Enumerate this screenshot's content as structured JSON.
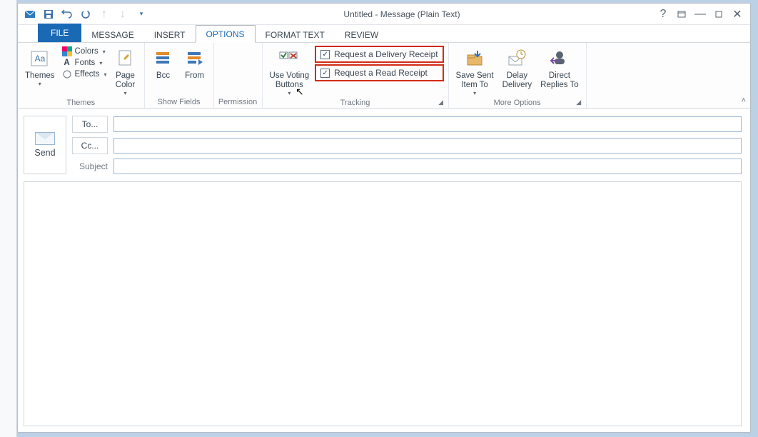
{
  "title": "Untitled - Message (Plain Text)",
  "qat": {
    "appicon": "outlook",
    "save": "save",
    "undo": "undo",
    "redo": "redo",
    "prev": "prev",
    "next": "next"
  },
  "tabs": {
    "file": "FILE",
    "message": "MESSAGE",
    "insert": "INSERT",
    "options": "OPTIONS",
    "format": "FORMAT TEXT",
    "review": "REVIEW"
  },
  "ribbon": {
    "themes": {
      "label": "Themes",
      "themes_btn": "Themes",
      "colors": "Colors",
      "fonts": "Fonts",
      "effects": "Effects",
      "page_color": "Page\nColor"
    },
    "showfields": {
      "label": "Show Fields",
      "bcc": "Bcc",
      "from": "From"
    },
    "permission": {
      "label": "Permission"
    },
    "tracking": {
      "label": "Tracking",
      "voting": "Use Voting\nButtons",
      "delivery": "Request a Delivery Receipt",
      "read": "Request a Read Receipt"
    },
    "more": {
      "label": "More Options",
      "save_sent": "Save Sent\nItem To",
      "delay": "Delay\nDelivery",
      "direct": "Direct\nReplies To"
    }
  },
  "compose": {
    "send": "Send",
    "to": "To...",
    "cc": "Cc...",
    "subject_label": "Subject",
    "to_value": "",
    "cc_value": "",
    "subject_value": "",
    "body": ""
  },
  "checked": {
    "delivery": true,
    "read": true
  }
}
